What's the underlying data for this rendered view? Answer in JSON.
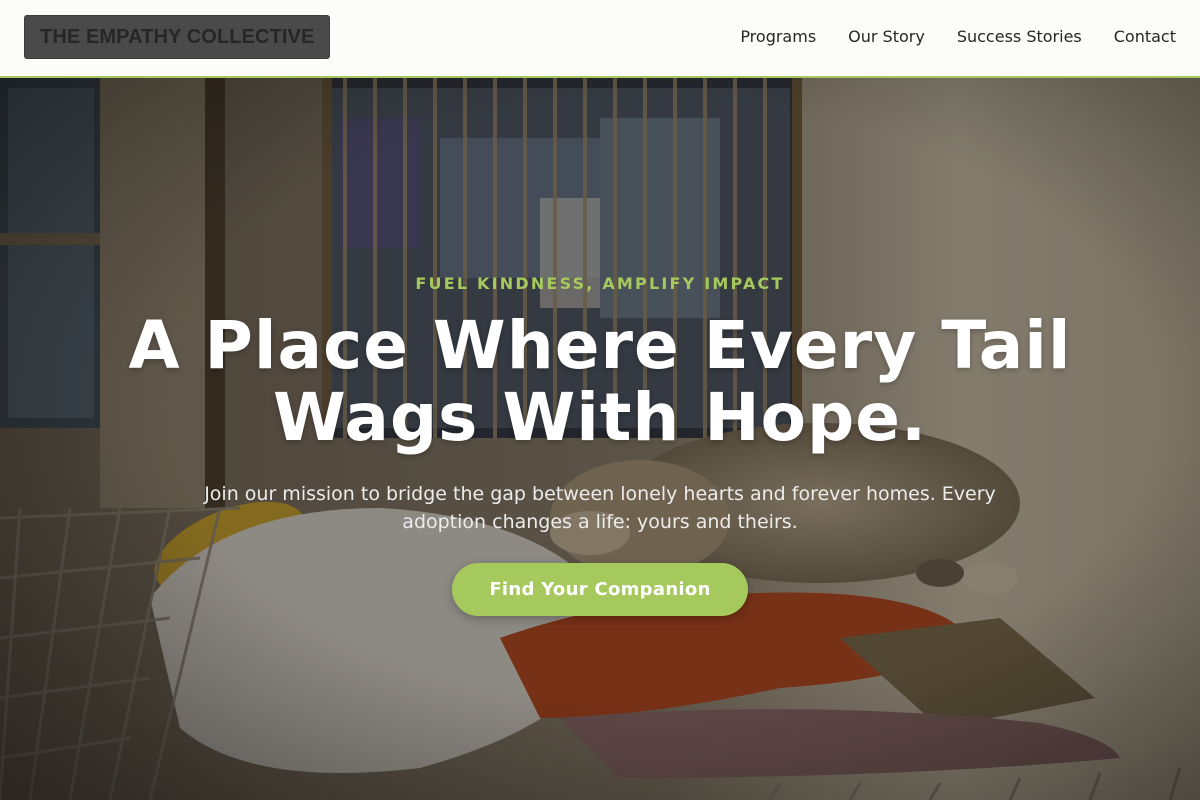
{
  "header": {
    "logo": "THE EMPATHY COLLECTIVE",
    "nav": [
      {
        "label": "Programs"
      },
      {
        "label": "Our Story"
      },
      {
        "label": "Success Stories"
      },
      {
        "label": "Contact"
      }
    ]
  },
  "hero": {
    "background_description_icon": "shelter-dog-photo",
    "tagline": "FUEL KINDNESS, AMPLIFY IMPACT",
    "headline": "A Place Where Every Tail Wags With Hope.",
    "subtext": "Join our mission to bridge the gap between lonely hearts and forever homes. Every adoption changes a life: yours and theirs.",
    "cta_label": "Find Your Companion"
  },
  "colors": {
    "accent": "#a6c95d",
    "header_bg": "#fcfcfa",
    "logo_bg": "#4a4a4a",
    "text_dark": "#262626"
  }
}
